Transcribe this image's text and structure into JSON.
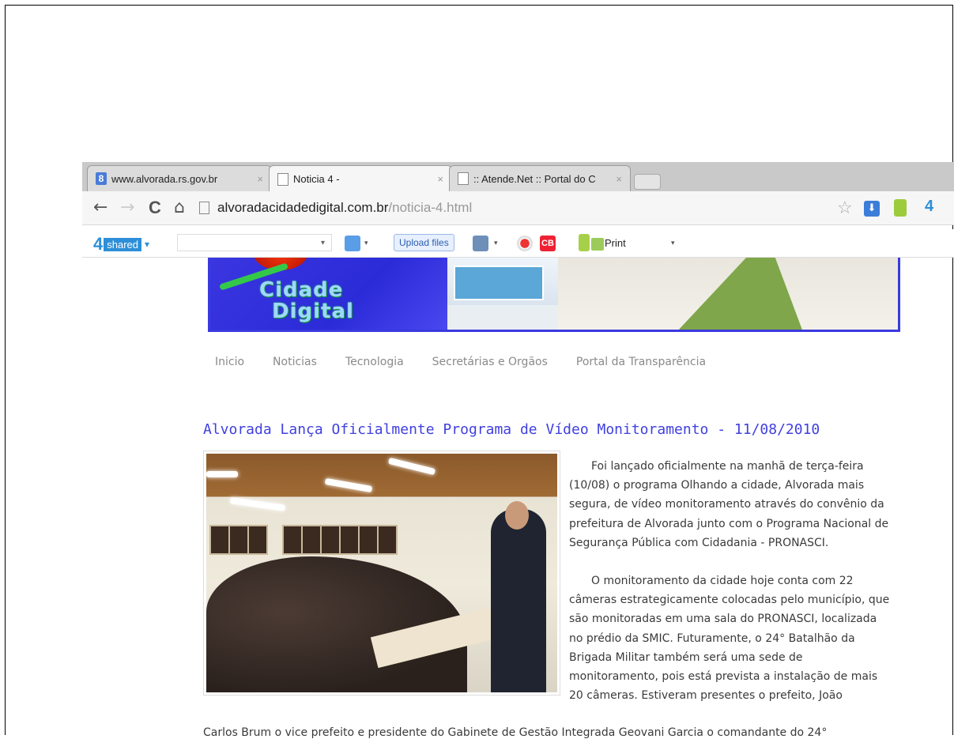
{
  "browser": {
    "tabs": [
      {
        "favicon": "google-icon",
        "favicon_glyph": "8",
        "label": "www.alvorada.rs.gov.br",
        "close": "×",
        "active": false
      },
      {
        "favicon": "page-icon",
        "label": "Noticia 4 -",
        "close": "×",
        "active": true
      },
      {
        "favicon": "page-icon",
        "label": ":: Atende.Net :: Portal do C",
        "close": "×",
        "active": false
      }
    ],
    "nav": {
      "back": "←",
      "forward": "→",
      "reload": "C",
      "home": "⌂"
    },
    "address": {
      "host": "alvoradacidadedigital.com.br",
      "path": "/noticia-4.html"
    },
    "star": "☆",
    "ext_download": "⬇",
    "ext_4": "4"
  },
  "extbar": {
    "logo_num": "4",
    "logo_shared": "shared",
    "logo_caret": "▾",
    "upload_label": "Upload files",
    "cb_label": "CB",
    "print_label": "Print",
    "caret": "▾"
  },
  "banner": {
    "line1": "Cidade",
    "line2": "Digital"
  },
  "nav": [
    "Inicio",
    "Noticias",
    "Tecnologia",
    "Secretárias e Orgãos",
    "Portal da Transparência"
  ],
  "article": {
    "headline": "Alvorada Lança Oficialmente Programa de Vídeo Monitoramento - 11/08/2010",
    "p1": "Foi lançado oficialmente na manhã de terça-feira (10/08) o programa Olhando a cidade, Alvorada mais segura, de vídeo monitoramento através do convênio da prefeitura de Alvorada junto com o Programa Nacional de Segurança Pública com Cidadania - PRONASCI.",
    "p2": "O monitoramento da cidade hoje conta com 22 câmeras estrategicamente colocadas pelo município, que são monitoradas em uma sala do PRONASCI, localizada no prédio da SMIC. Futuramente, o 24° Batalhão da Brigada Militar também será uma sede de monitoramento, pois está prevista a instalação de mais 20 câmeras. Estiveram presentes o prefeito, João",
    "p2_overflow": "Carlos Brum o vice prefeito e presidente do Gabinete de Gestão Integrada Geovani Garcia o comandante do 24°"
  }
}
